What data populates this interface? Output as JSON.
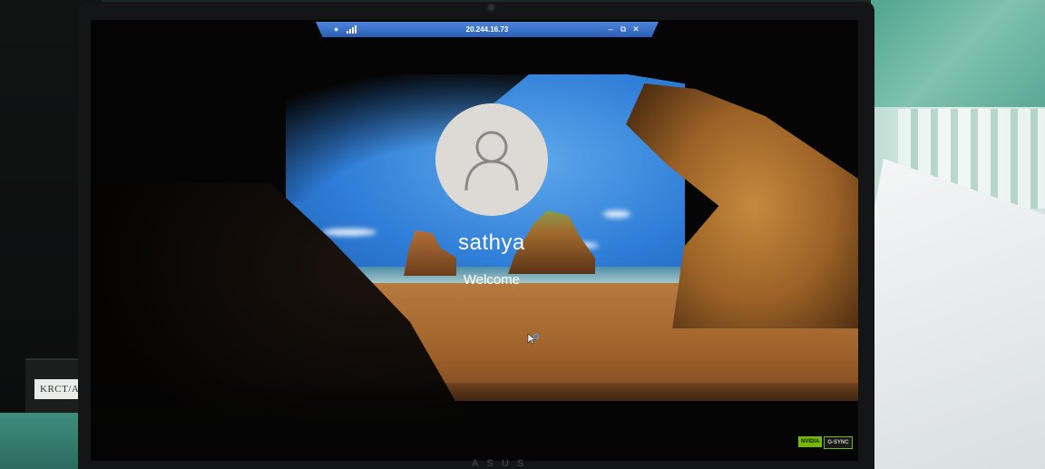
{
  "rdp_bar": {
    "title": "20.244.16.73",
    "pin_icon": "pin-icon",
    "signal_icon": "connection-signal-icon",
    "minimize_glyph": "–",
    "restore_glyph": "⧉",
    "close_glyph": "✕"
  },
  "lock_screen": {
    "username": "sathya",
    "status": "Welcome",
    "avatar_icon": "user-avatar-icon",
    "cursor_icon": "busy-cursor-icon"
  },
  "environment": {
    "sticker_text": "KRCT/AI",
    "badge_nvidia": "NVIDIA",
    "badge_gsync": "G-SYNC",
    "laptop_logo": "ASUS"
  },
  "colors": {
    "rdp_bar": "#2a5fb8",
    "sky": "#2f7ed8",
    "sand": "#a1642c",
    "avatar_bg": "#ddd9d5",
    "avatar_line": "#8a8784",
    "nvidia_green": "#76b900"
  }
}
